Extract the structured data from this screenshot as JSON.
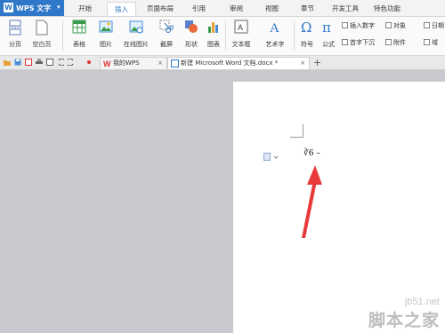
{
  "app": {
    "logo_letter": "W",
    "title": "WPS 文字",
    "dropdown": "▾"
  },
  "menu_tabs": [
    "开始",
    "插入",
    "页面布局",
    "引用",
    "审阅",
    "视图",
    "章节",
    "开发工具",
    "特色功能"
  ],
  "active_tab": "插入",
  "ribbon": {
    "buttons": [
      "分页",
      "空白页",
      "表格",
      "图片",
      "在线图片",
      "截屏",
      "形状",
      "图表",
      "文本框",
      "艺术字",
      "符号",
      "公式"
    ],
    "small": [
      "插入数字",
      "对象",
      "日期",
      "首字下沉",
      "附件",
      "域"
    ]
  },
  "doc_tabs": [
    {
      "label": "我的WPS",
      "close": "×"
    },
    {
      "label": "新建 Microsoft Word 文档.docx *",
      "close": "×"
    }
  ],
  "new_tab": "+",
  "document": {
    "formula": "∛6 –"
  },
  "watermark": {
    "site": "jb51.net",
    "name": "脚本之家"
  },
  "colors": {
    "brand": "#2f77c9",
    "arrow": "#e8393b"
  }
}
